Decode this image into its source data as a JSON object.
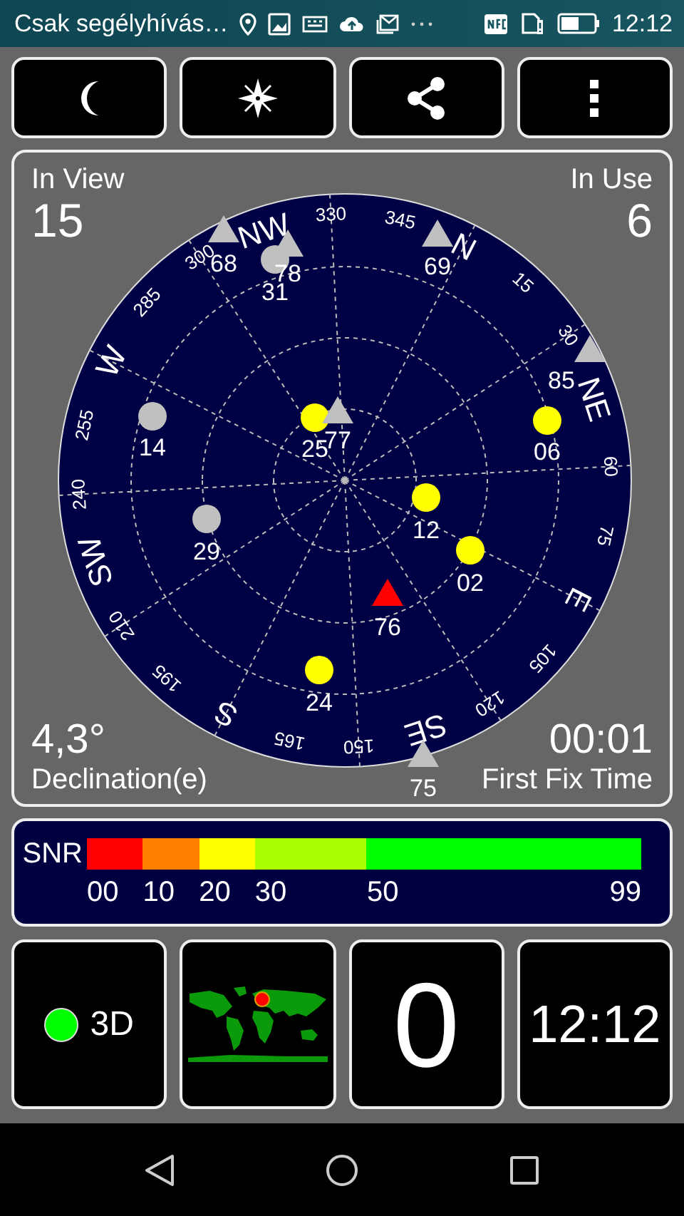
{
  "status_bar": {
    "carrier_text": "Csak segélyhívás…",
    "time": "12:12"
  },
  "sky_view": {
    "in_view_label": "In View",
    "in_view": "15",
    "in_use_label": "In Use",
    "in_use": "6",
    "declination": "4,3°",
    "declination_label": "Declination(e)",
    "first_fix": "00:01",
    "first_fix_label": "First Fix Time",
    "directions": [
      "N",
      "NE",
      "E",
      "SE",
      "S",
      "SW",
      "W",
      "NW"
    ],
    "bearings": [
      "15",
      "30",
      "60",
      "75",
      "105",
      "120",
      "150",
      "165",
      "195",
      "210",
      "240",
      "255",
      "285",
      "300",
      "330",
      "345"
    ],
    "satellites": [
      {
        "id": "31",
        "kind": "circle",
        "color": "#c0c0c0"
      },
      {
        "id": "68",
        "kind": "triangle",
        "color": "#c0c0c0"
      },
      {
        "id": "78",
        "kind": "triangle",
        "color": "#c0c0c0"
      },
      {
        "id": "69",
        "kind": "triangle",
        "color": "#c0c0c0"
      },
      {
        "id": "85",
        "kind": "triangle",
        "color": "#c0c0c0"
      },
      {
        "id": "14",
        "kind": "circle",
        "color": "#c0c0c0"
      },
      {
        "id": "25",
        "kind": "circle",
        "color": "#ffff00"
      },
      {
        "id": "77",
        "kind": "triangle",
        "color": "#c0c0c0"
      },
      {
        "id": "06",
        "kind": "circle",
        "color": "#ffff00"
      },
      {
        "id": "12",
        "kind": "circle",
        "color": "#ffff00"
      },
      {
        "id": "29",
        "kind": "circle",
        "color": "#c0c0c0"
      },
      {
        "id": "02",
        "kind": "circle",
        "color": "#ffff00"
      },
      {
        "id": "76",
        "kind": "triangle",
        "color": "#ff0000"
      },
      {
        "id": "24",
        "kind": "circle",
        "color": "#ffff00"
      },
      {
        "id": "75",
        "kind": "triangle",
        "color": "#c0c0c0"
      }
    ]
  },
  "snr": {
    "label": "SNR",
    "segments": [
      {
        "color": "#ff0000"
      },
      {
        "color": "#ff8000"
      },
      {
        "color": "#ffff00"
      },
      {
        "color": "#aaff00"
      },
      {
        "color": "#00ff00"
      }
    ],
    "ticks": [
      "00",
      "10",
      "20",
      "30",
      "50",
      "99"
    ]
  },
  "tiles": {
    "fix": {
      "label": "3D",
      "color": "#00ff00"
    },
    "tile_3": "0",
    "clock": "12:12"
  }
}
